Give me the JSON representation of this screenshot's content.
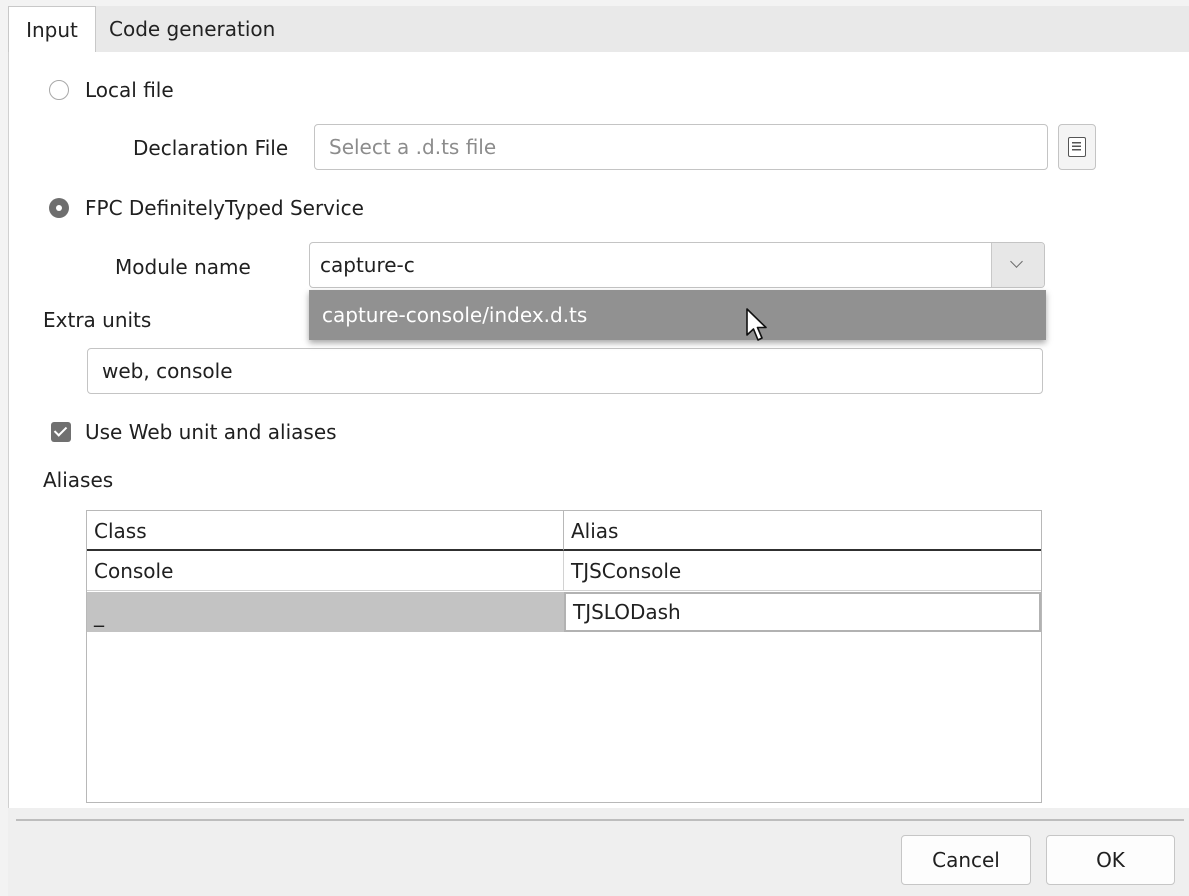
{
  "tabs": [
    {
      "label": "Input",
      "active": true
    },
    {
      "label": "Code generation",
      "active": false
    }
  ],
  "local_file": {
    "label": "Local file",
    "selected": false
  },
  "declaration_file": {
    "label": "Declaration File",
    "placeholder": "Select a .d.ts file",
    "value": "",
    "browse_icon": "file-browse-icon"
  },
  "service": {
    "label": "FPC DefinitelyTyped Service",
    "selected": true
  },
  "module_name": {
    "label": "Module name",
    "value": "capture-c",
    "dropdown_open": true,
    "options": [
      "capture-console/index.d.ts"
    ]
  },
  "extra_units": {
    "label": "Extra units",
    "value": "web, console"
  },
  "use_web_unit": {
    "label": "Use Web unit and aliases",
    "checked": true
  },
  "aliases": {
    "label": "Aliases",
    "columns": [
      "Class",
      "Alias"
    ],
    "rows": [
      {
        "class": "Console",
        "alias": "TJSConsole"
      },
      {
        "class": "_",
        "alias": "TJSLODash"
      }
    ]
  },
  "buttons": {
    "cancel": "Cancel",
    "ok": "OK"
  },
  "colors": {
    "selection": "#c3c3c3",
    "popup": "#919191",
    "accent": "#6e6e6e"
  }
}
